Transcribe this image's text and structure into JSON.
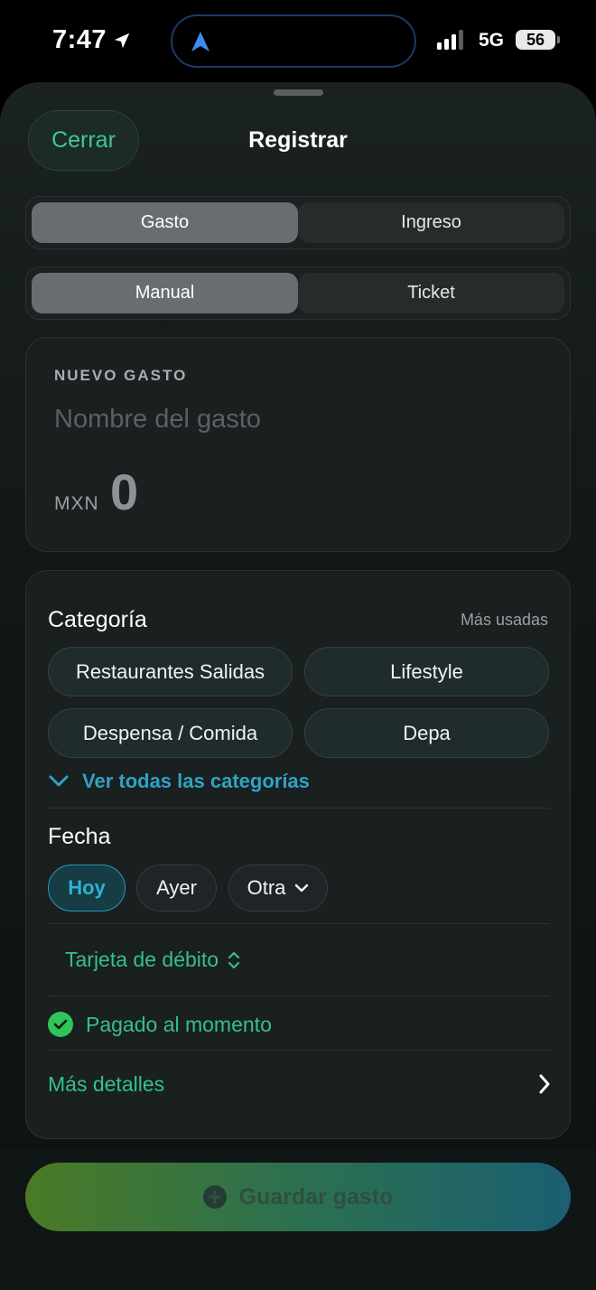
{
  "status_bar": {
    "time": "7:47",
    "network": "5G",
    "battery": "56"
  },
  "header": {
    "close_label": "Cerrar",
    "title": "Registrar"
  },
  "type_segment": {
    "options": [
      "Gasto",
      "Ingreso"
    ],
    "selected": "Gasto"
  },
  "mode_segment": {
    "options": [
      "Manual",
      "Ticket"
    ],
    "selected": "Manual"
  },
  "entry_card": {
    "eyebrow": "NUEVO GASTO",
    "name_placeholder": "Nombre del gasto",
    "currency": "MXN",
    "amount": "0"
  },
  "category": {
    "title": "Categoría",
    "hint": "Más usadas",
    "chips": [
      "Restaurantes Salidas",
      "Lifestyle",
      "Despensa / Comida",
      "Depa"
    ],
    "see_all": "Ver todas las categorías"
  },
  "date": {
    "title": "Fecha",
    "options": [
      "Hoy",
      "Ayer",
      "Otra"
    ],
    "selected": "Hoy"
  },
  "payment_method": "Tarjeta de débito",
  "paid_status": "Pagado al momento",
  "more_details": "Más detalles",
  "save_button": "Guardar gasto",
  "colors": {
    "accent_green": "#34c08c",
    "accent_blue": "#2fa3c4",
    "check_green": "#2fc55a"
  }
}
